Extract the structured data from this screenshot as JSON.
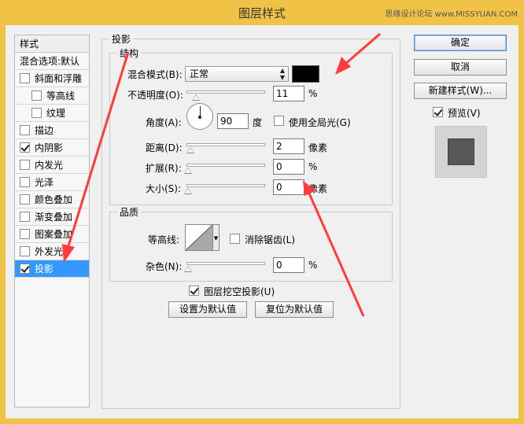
{
  "window": {
    "title": "图层样式",
    "watermark": "思缘设计论坛 www.MISSYUAN.COM"
  },
  "left_list": {
    "header": "样式",
    "items": [
      {
        "label": "混合选项:默认",
        "checkbox": false,
        "checked": false,
        "sub": false,
        "selected": false
      },
      {
        "label": "斜面和浮雕",
        "checkbox": true,
        "checked": false,
        "sub": false,
        "selected": false
      },
      {
        "label": "等高线",
        "checkbox": true,
        "checked": false,
        "sub": true,
        "selected": false
      },
      {
        "label": "纹理",
        "checkbox": true,
        "checked": false,
        "sub": true,
        "selected": false
      },
      {
        "label": "描边",
        "checkbox": true,
        "checked": false,
        "sub": false,
        "selected": false
      },
      {
        "label": "内阴影",
        "checkbox": true,
        "checked": true,
        "sub": false,
        "selected": false
      },
      {
        "label": "内发光",
        "checkbox": true,
        "checked": false,
        "sub": false,
        "selected": false
      },
      {
        "label": "光泽",
        "checkbox": true,
        "checked": false,
        "sub": false,
        "selected": false
      },
      {
        "label": "颜色叠加",
        "checkbox": true,
        "checked": false,
        "sub": false,
        "selected": false
      },
      {
        "label": "渐变叠加",
        "checkbox": true,
        "checked": false,
        "sub": false,
        "selected": false
      },
      {
        "label": "图案叠加",
        "checkbox": true,
        "checked": false,
        "sub": false,
        "selected": false
      },
      {
        "label": "外发光",
        "checkbox": true,
        "checked": false,
        "sub": false,
        "selected": false
      },
      {
        "label": "投影",
        "checkbox": true,
        "checked": true,
        "sub": false,
        "selected": true
      }
    ]
  },
  "drop_shadow": {
    "title": "投影",
    "structure": {
      "title": "结构",
      "blend_mode_label": "混合模式(B):",
      "blend_mode_value": "正常",
      "shadow_color": "#000000",
      "opacity_label": "不透明度(O):",
      "opacity_value": "11",
      "opacity_unit": "%",
      "opacity_level": 0.11,
      "angle_label": "角度(A):",
      "angle_value": "90",
      "angle_unit": "度",
      "global_light_label": "使用全局光(G)",
      "global_light_checked": false,
      "distance_label": "距离(D):",
      "distance_value": "2",
      "distance_unit": "像素",
      "spread_label": "扩展(R):",
      "spread_value": "0",
      "spread_unit": "%",
      "size_label": "大小(S):",
      "size_value": "0",
      "size_unit": "像素"
    },
    "quality": {
      "title": "品质",
      "contour_label": "等高线:",
      "anti_alias_label": "消除锯齿(L)",
      "anti_alias_checked": false,
      "noise_label": "杂色(N):",
      "noise_value": "0",
      "noise_unit": "%"
    },
    "knockout_label": "图层挖空投影(U)",
    "knockout_checked": true,
    "make_default_label": "设置为默认值",
    "reset_default_label": "复位为默认值"
  },
  "buttons": {
    "ok": "确定",
    "cancel": "取消",
    "new_style": "新建样式(W)...",
    "preview_label": "预览(V)",
    "preview_checked": true
  },
  "annotation_color": "#ff3b3b"
}
